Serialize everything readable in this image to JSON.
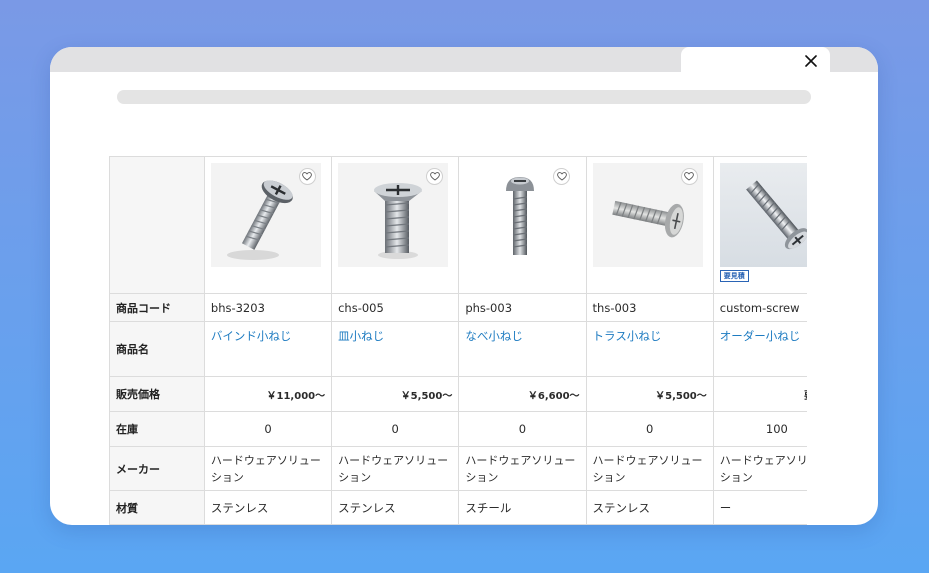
{
  "table": {
    "row_headers": {
      "code": "商品コード",
      "name": "商品名",
      "price": "販売価格",
      "stock": "在庫",
      "maker": "メーカー",
      "material": "材質"
    },
    "products": [
      {
        "code": "bhs-3203",
        "name": "バインド小ねじ",
        "price": "￥11,000～",
        "stock": "0",
        "maker": "ハードウェアソリューション",
        "material": "ステンレス",
        "image_icon": "bind-screw-image",
        "badge": ""
      },
      {
        "code": "chs-005",
        "name": "皿小ねじ",
        "price": "￥5,500～",
        "stock": "0",
        "maker": "ハードウェアソリューション",
        "material": "ステンレス",
        "image_icon": "flat-screw-image",
        "badge": ""
      },
      {
        "code": "phs-003",
        "name": "なべ小ねじ",
        "price": "￥6,600～",
        "stock": "0",
        "maker": "ハードウェアソリューション",
        "material": "スチール",
        "image_icon": "pan-screw-image",
        "badge": ""
      },
      {
        "code": "ths-003",
        "name": "トラス小ねじ",
        "price": "￥5,500～",
        "stock": "0",
        "maker": "ハードウェアソリューション",
        "material": "ステンレス",
        "image_icon": "truss-screw-image",
        "badge": ""
      },
      {
        "code": "custom-screw",
        "name": "オーダー小ねじ",
        "price": "要見積",
        "stock": "100",
        "maker": "ハードウェアソリューション",
        "material": "ー",
        "image_icon": "custom-screw-image",
        "badge": "要見積"
      }
    ]
  },
  "colors": {
    "link": "#1d7bc1",
    "badge": "#2a64b5",
    "background_top": "#7a99e6",
    "background_bottom": "#5aa6f3"
  },
  "icons": {
    "close": "close-icon",
    "favorite": "heart-icon"
  }
}
